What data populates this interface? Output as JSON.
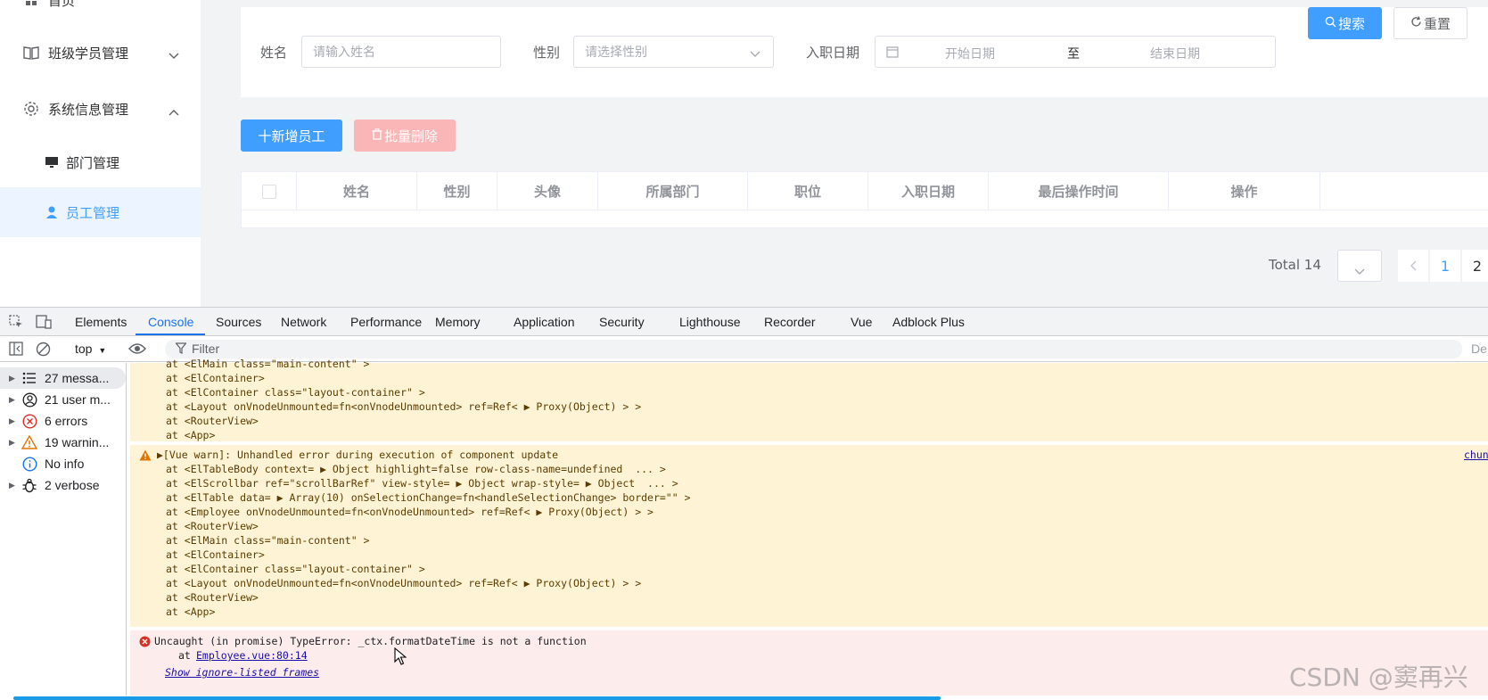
{
  "sidebar": {
    "top_partial": "首页",
    "items": [
      {
        "label": "班级学员管理",
        "icon": "book-icon"
      },
      {
        "label": "系统信息管理",
        "icon": "gear-icon"
      }
    ],
    "sub_items": [
      {
        "label": "部门管理",
        "icon": "monitor-icon"
      },
      {
        "label": "员工管理",
        "icon": "user-icon",
        "active": true
      }
    ]
  },
  "search": {
    "name_label": "姓名",
    "name_placeholder": "请输入姓名",
    "gender_label": "性别",
    "gender_placeholder": "请选择性别",
    "date_label": "入职日期",
    "start_placeholder": "开始日期",
    "range_sep": "至",
    "end_placeholder": "结束日期",
    "search_button": "搜索",
    "reset_button": "重置"
  },
  "actions": {
    "add_button": "十新增员工",
    "batch_delete_button": "批量删除"
  },
  "table": {
    "columns": [
      "姓名",
      "性别",
      "头像",
      "所属部门",
      "职位",
      "入职日期",
      "最后操作时间",
      "操作"
    ]
  },
  "pagination": {
    "total": "Total 14",
    "pages": [
      "1",
      "2"
    ],
    "current": "1"
  },
  "devtools": {
    "tabs": [
      "Elements",
      "Console",
      "Sources",
      "Network",
      "Performance",
      "Memory",
      "Application",
      "Security",
      "Lighthouse",
      "Recorder",
      "Vue",
      "Adblock Plus"
    ],
    "active_tab": "Console",
    "context": "top",
    "filter_placeholder": "Filter",
    "right_cut": "De",
    "side": [
      {
        "label": "27 messa...",
        "icon": "list-icon"
      },
      {
        "label": "21 user m...",
        "icon": "user-circle-icon"
      },
      {
        "label": "6 errors",
        "icon": "error-icon"
      },
      {
        "label": "19 warnin...",
        "icon": "warning-icon"
      },
      {
        "label": "No info",
        "icon": "info-icon"
      },
      {
        "label": "2 verbose",
        "icon": "bug-icon"
      }
    ],
    "block1": [
      "at <ElMain class=\"main-content\" >",
      "at <ElContainer>",
      "at <ElContainer class=\"layout-container\" >",
      "at <Layout onVnodeUnmounted=fn<onVnodeUnmounted> ref=Ref< ▶ Proxy(Object) > >",
      "at <RouterView>",
      "at <App>"
    ],
    "warn_header": "▶[Vue warn]: Unhandled error during execution of component update",
    "warn_source": "chun",
    "block2": [
      "at <ElTableBody context= ▶ Object highlight=false row-class-name=undefined  ... >",
      "at <ElScrollbar ref=\"scrollBarRef\" view-style= ▶ Object wrap-style= ▶ Object  ... >",
      "at <ElTable data= ▶ Array(10) onSelectionChange=fn<handleSelectionChange> border=\"\" >",
      "at <Employee onVnodeUnmounted=fn<onVnodeUnmounted> ref=Ref< ▶ Proxy(Object) > >",
      "at <RouterView>",
      "at <ElMain class=\"main-content\" >",
      "at <ElContainer>",
      "at <ElContainer class=\"layout-container\" >",
      "at <Layout onVnodeUnmounted=fn<onVnodeUnmounted> ref=Ref< ▶ Proxy(Object) > >",
      "at <RouterView>",
      "at <App>"
    ],
    "error_line": "Uncaught (in promise) TypeError: _ctx.formatDateTime is not a function",
    "error_at": "at",
    "error_link": "Employee.vue:80:14",
    "ignore_link": "Show ignore-listed frames"
  },
  "watermark": "CSDN @窦再兴",
  "colors": {
    "primary": "#409eff",
    "danger_disabled": "#fab6b6",
    "warn_bg": "#fef4d5",
    "error_bg": "#fcecec",
    "devtools_blue": "#1a73e8"
  }
}
